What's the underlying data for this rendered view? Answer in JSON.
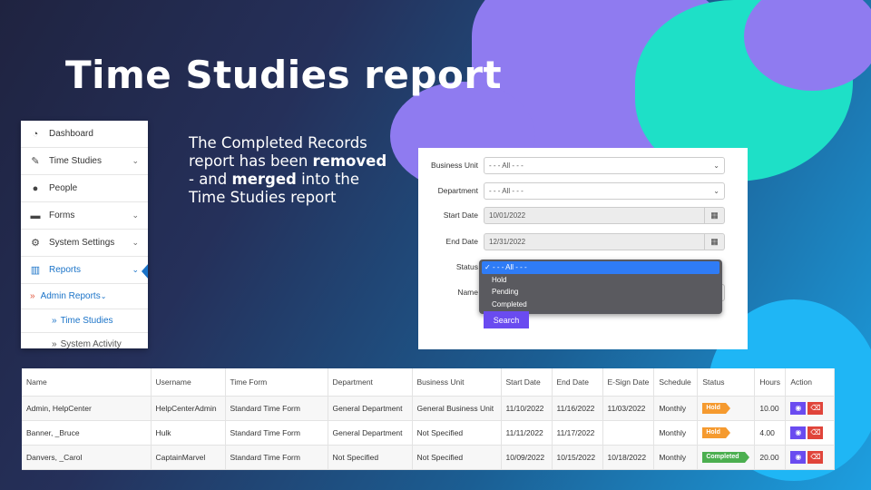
{
  "slide": {
    "title": "Time Studies report",
    "caption": {
      "p1": "The Completed Records report has been ",
      "b1": "removed",
      "p2": " - and ",
      "b2": "merged",
      "p3": " into the Time Studies report"
    }
  },
  "sidebar": {
    "items": [
      {
        "label": "Dashboard",
        "icon": "dashboard-icon",
        "glyph": "◔",
        "chevron": false
      },
      {
        "label": "Time Studies",
        "icon": "edit-icon",
        "glyph": "✎",
        "chevron": true
      },
      {
        "label": "People",
        "icon": "people-icon",
        "glyph": "👥",
        "chevron": false
      },
      {
        "label": "Forms",
        "icon": "briefcase-icon",
        "glyph": "▬",
        "chevron": true
      },
      {
        "label": "System Settings",
        "icon": "gear-icon",
        "glyph": "⚙",
        "chevron": true
      },
      {
        "label": "Reports",
        "icon": "chart-icon",
        "glyph": "▥",
        "chevron": true
      }
    ],
    "sub": {
      "mark": "»",
      "label": "Admin Reports"
    },
    "sub_items": [
      {
        "label": "Time Studies"
      },
      {
        "label": "System Activity"
      }
    ],
    "accent": "#1a73c8"
  },
  "filters": {
    "business_unit": {
      "label": "Business Unit",
      "value": "- - - All - - -"
    },
    "department": {
      "label": "Department",
      "value": "- - - All - - -"
    },
    "start_date": {
      "label": "Start Date",
      "value": "10/01/2022"
    },
    "end_date": {
      "label": "End Date",
      "value": "12/31/2022"
    },
    "status": {
      "label": "Status",
      "options": [
        "- - - All - - -",
        "Hold",
        "Pending",
        "Completed"
      ],
      "selected": "- - - All - - -"
    },
    "name": {
      "label": "Name"
    },
    "search_label": "Search",
    "button_color": "#6a4bf0"
  },
  "table": {
    "columns": [
      "Name",
      "Username",
      "Time Form",
      "Department",
      "Business Unit",
      "Start Date",
      "End Date",
      "E-Sign Date",
      "Schedule",
      "Status",
      "Hours",
      "Action"
    ],
    "rows": [
      {
        "name": "Admin, HelpCenter",
        "username": "HelpCenterAdmin",
        "time_form": "Standard Time Form",
        "department": "General Department",
        "business_unit": "General Business Unit",
        "start_date": "11/10/2022",
        "end_date": "11/16/2022",
        "esign_date": "11/03/2022",
        "schedule": "Monthly",
        "status": "Hold",
        "hours": "10.00"
      },
      {
        "name": "Banner, _Bruce",
        "username": "Hulk",
        "time_form": "Standard Time Form",
        "department": "General Department",
        "business_unit": "Not Specified",
        "start_date": "11/11/2022",
        "end_date": "11/17/2022",
        "esign_date": "",
        "schedule": "Monthly",
        "status": "Hold",
        "hours": "4.00"
      },
      {
        "name": "Danvers, _Carol",
        "username": "CaptainMarvel",
        "time_form": "Standard Time Form",
        "department": "Not Specified",
        "business_unit": "Not Specified",
        "start_date": "10/09/2022",
        "end_date": "10/15/2022",
        "esign_date": "10/18/2022",
        "schedule": "Monthly",
        "status": "Completed",
        "hours": "20.00"
      }
    ],
    "status_colors": {
      "Hold": "#f59a2f",
      "Completed": "#4caf50"
    },
    "action_icons": {
      "view": "eye-icon",
      "delete": "trash-icon"
    }
  }
}
